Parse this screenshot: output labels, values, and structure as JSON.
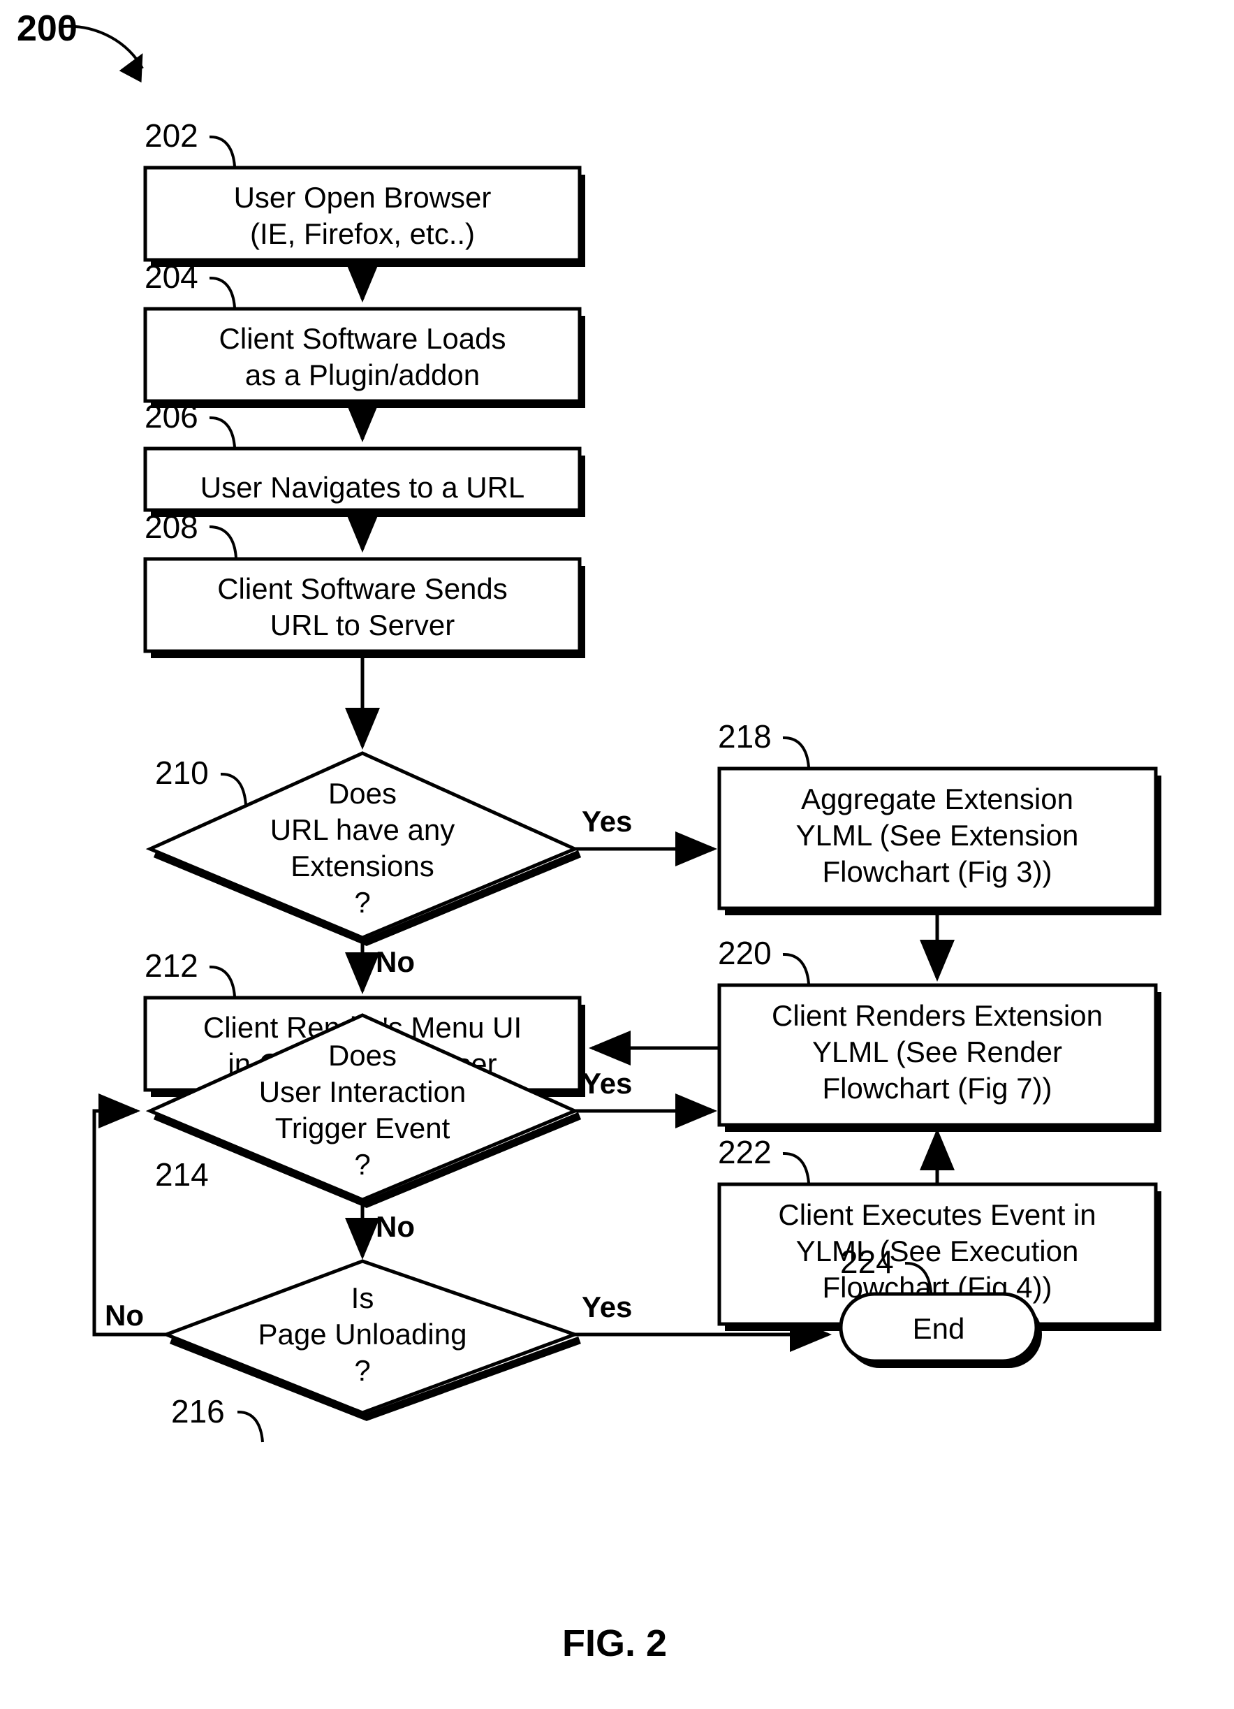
{
  "figure": {
    "diagram_number": "200",
    "caption": "FIG. 2"
  },
  "chart_data": {
    "type": "diagram",
    "title": "FIG. 2",
    "nodes": [
      {
        "ref": "202",
        "shape": "process",
        "lines": [
          "User Open Browser",
          "(IE, Firefox, etc..)"
        ]
      },
      {
        "ref": "204",
        "shape": "process",
        "lines": [
          "Client Software Loads",
          "as a Plugin/addon"
        ]
      },
      {
        "ref": "206",
        "shape": "process",
        "lines": [
          "User Navigates to a URL"
        ]
      },
      {
        "ref": "208",
        "shape": "process",
        "lines": [
          "Client Software Sends",
          "URL to Server"
        ]
      },
      {
        "ref": "210",
        "shape": "decision",
        "lines": [
          "Does",
          "URL have any",
          "Extensions",
          "?"
        ]
      },
      {
        "ref": "212",
        "shape": "process",
        "lines": [
          "Client Render's Menu UI",
          "in Corner of Browser"
        ]
      },
      {
        "ref": "214",
        "shape": "decision",
        "lines": [
          "Does",
          "User Interaction",
          "Trigger Event",
          "?"
        ]
      },
      {
        "ref": "216",
        "shape": "decision",
        "lines": [
          "Is",
          "Page Unloading",
          "?"
        ]
      },
      {
        "ref": "218",
        "shape": "process",
        "lines": [
          "Aggregate Extension",
          "YLML (See Extension",
          "Flowchart (Fig 3))"
        ]
      },
      {
        "ref": "220",
        "shape": "process",
        "lines": [
          "Client Renders Extension",
          "YLML (See Render",
          "Flowchart (Fig 7))"
        ]
      },
      {
        "ref": "222",
        "shape": "process",
        "lines": [
          "Client Executes Event in",
          "YLML (See Execution",
          "Flowchart (Fig 4))"
        ]
      },
      {
        "ref": "224",
        "shape": "terminator",
        "lines": [
          "End"
        ]
      }
    ],
    "edges": [
      {
        "from": "202",
        "to": "204",
        "label": ""
      },
      {
        "from": "204",
        "to": "206",
        "label": ""
      },
      {
        "from": "206",
        "to": "208",
        "label": ""
      },
      {
        "from": "208",
        "to": "210",
        "label": ""
      },
      {
        "from": "210",
        "to": "218",
        "label": "Yes"
      },
      {
        "from": "210",
        "to": "212",
        "label": "No"
      },
      {
        "from": "218",
        "to": "220",
        "label": ""
      },
      {
        "from": "220",
        "to": "212",
        "label": ""
      },
      {
        "from": "212",
        "to": "214",
        "label": ""
      },
      {
        "from": "214",
        "to": "222",
        "label": "Yes"
      },
      {
        "from": "214",
        "to": "216",
        "label": "No"
      },
      {
        "from": "222",
        "to": "220",
        "label": ""
      },
      {
        "from": "216",
        "to": "224",
        "label": "Yes"
      },
      {
        "from": "216",
        "to": "214",
        "label": "No"
      }
    ]
  },
  "refs": {
    "n200": "200",
    "n202": "202",
    "n204": "204",
    "n206": "206",
    "n208": "208",
    "n210": "210",
    "n212": "212",
    "n214": "214",
    "n216": "216",
    "n218": "218",
    "n220": "220",
    "n222": "222",
    "n224": "224"
  },
  "nodes": {
    "n202": {
      "l1": "User Open Browser",
      "l2": "(IE, Firefox, etc..)"
    },
    "n204": {
      "l1": "Client Software Loads",
      "l2": "as a Plugin/addon"
    },
    "n206": {
      "l1": "User Navigates to a URL"
    },
    "n208": {
      "l1": "Client Software Sends",
      "l2": "URL to Server"
    },
    "n210": {
      "l1": "Does",
      "l2": "URL have any",
      "l3": "Extensions",
      "l4": "?"
    },
    "n212": {
      "l1": "Client Render's Menu UI",
      "l2": "in Corner of Browser"
    },
    "n214": {
      "l1": "Does",
      "l2": "User Interaction",
      "l3": "Trigger Event",
      "l4": "?"
    },
    "n216": {
      "l1": "Is",
      "l2": "Page Unloading",
      "l3": "?"
    },
    "n218": {
      "l1": "Aggregate Extension",
      "l2": "YLML (See Extension",
      "l3": "Flowchart (Fig 3))"
    },
    "n220": {
      "l1": "Client Renders Extension",
      "l2": "YLML (See Render",
      "l3": "Flowchart (Fig 7))"
    },
    "n222": {
      "l1": "Client Executes Event in",
      "l2": "YLML (See Execution",
      "l3": "Flowchart (Fig 4))"
    },
    "n224": {
      "l1": "End"
    }
  },
  "labels": {
    "yes_210": "Yes",
    "no_210": "No",
    "yes_214": "Yes",
    "no_214": "No",
    "yes_216": "Yes",
    "no_216": "No"
  },
  "colors": {
    "ink": "#000000",
    "paper": "#ffffff"
  }
}
